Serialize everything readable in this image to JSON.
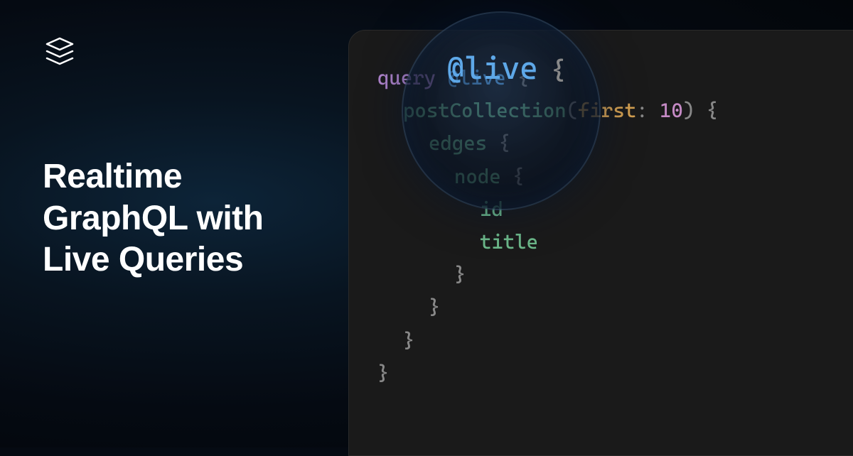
{
  "heading": {
    "line1": "Realtime",
    "line2": "GraphQL with",
    "line3": "Live Queries"
  },
  "magnifier": {
    "text": "@live",
    "brace": "{"
  },
  "code": {
    "keyword_query": "query",
    "directive": "@live",
    "brace_open": "{",
    "brace_close": "}",
    "field_postCollection": "postCollection",
    "paren_open": "(",
    "paren_close": ")",
    "arg_first": "first",
    "colon": ":",
    "val_10": "10",
    "field_edges": "edges",
    "field_node": "node",
    "field_id": "id",
    "field_title": "title"
  }
}
